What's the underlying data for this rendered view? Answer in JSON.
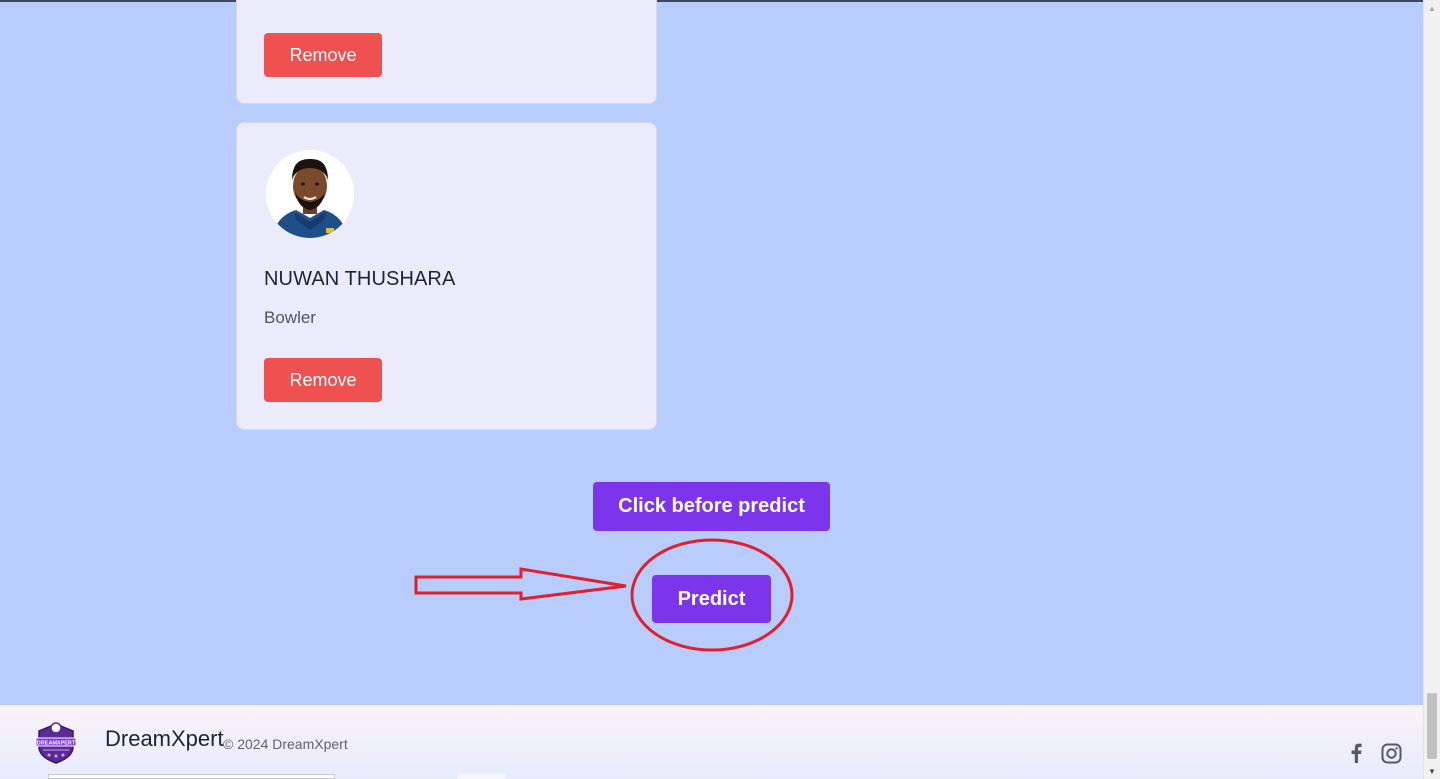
{
  "players": [
    {
      "remove_label": "Remove"
    },
    {
      "name": "NUWAN THUSHARA",
      "role": "Bowler",
      "remove_label": "Remove"
    }
  ],
  "actions": {
    "click_before_label": "Click before predict",
    "predict_label": "Predict"
  },
  "footer": {
    "brand": "DreamXpert",
    "copyright": "© 2024 DreamXpert",
    "logo_text": "DREAMXPERT",
    "social": [
      "facebook-icon",
      "instagram-icon"
    ]
  },
  "colors": {
    "background": "#b8cdfc",
    "card": "#ecebfc",
    "remove_button": "#ef5050",
    "primary_button": "#7c35eb",
    "annotation": "#e0202e"
  }
}
